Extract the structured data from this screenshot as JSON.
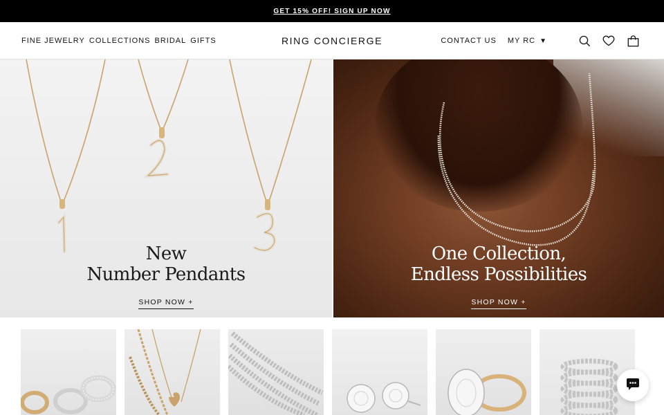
{
  "promo": {
    "text": "GET 15% OFF! SIGN UP NOW"
  },
  "nav": {
    "left": [
      "FINE JEWELRY",
      "COLLECTIONS",
      "BRIDAL",
      "GIFTS"
    ],
    "logo": "RING CONCIERGE",
    "contact": "CONTACT US",
    "account": "MY RC"
  },
  "icons": {
    "search": "search-icon",
    "wishlist": "heart-icon",
    "cart": "shopping-bag-icon",
    "chat": "chat-icon",
    "dropdown": "caret-down-icon"
  },
  "hero": {
    "left": {
      "title_line1": "New",
      "title_line2": "Number Pendants",
      "cta": "SHOP NOW +"
    },
    "right": {
      "title_line1": "One Collection,",
      "title_line2": "Endless Possibilities",
      "cta": "SHOP NOW +"
    }
  },
  "colors": {
    "promo_bg": "#000000",
    "text": "#111111",
    "gold": "#d2ad73",
    "skin": "#6e3c22"
  }
}
